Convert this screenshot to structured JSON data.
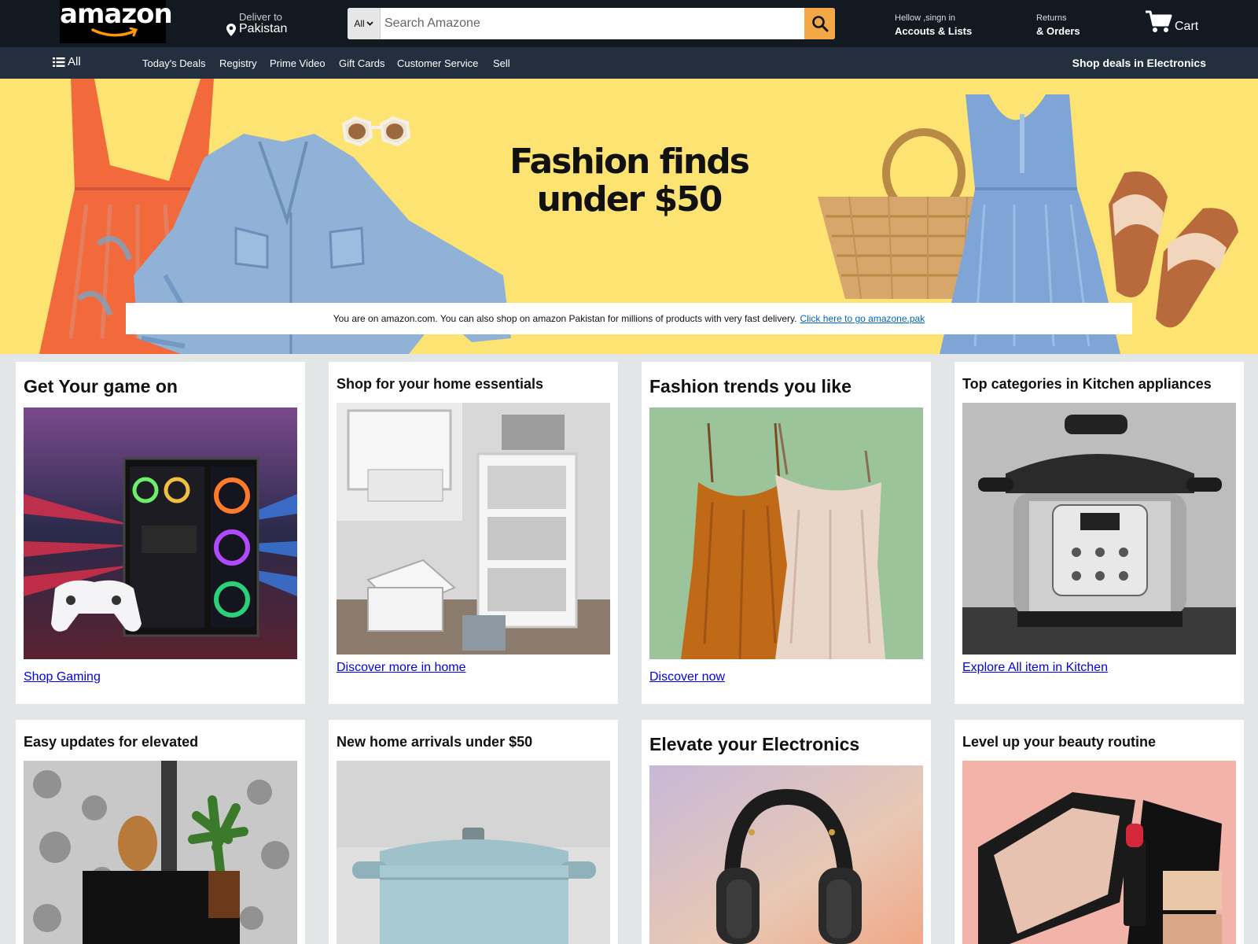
{
  "header": {
    "logo_text": "amazon",
    "deliver_label": "Deliver to",
    "deliver_location": "Pakistan",
    "search_category": "All",
    "search_placeholder": "Search Amazone",
    "account_greeting": "Hellow ,singn in",
    "account_label": "Accouts & Lists",
    "returns_label": "Returns",
    "orders_label": "& Orders",
    "cart_label": "Cart"
  },
  "subnav": {
    "all_label": "All",
    "items": [
      "Today's Deals",
      "Registry",
      "Prime Video",
      "Gift Cards",
      "Customer Service",
      "Sell"
    ],
    "promo": "Shop deals in Electronics"
  },
  "hero": {
    "title_line1": "Fashion finds",
    "title_line2": "under $50",
    "notice_text": "You are on amazon.com. You can also shop on amazon Pakistan for millions of products with very fast delivery.",
    "notice_link": "Click here to go amazone.pak"
  },
  "cards": [
    {
      "title": "Get Your game on",
      "link": "Shop Gaming",
      "image": "gaming-pc-and-controller"
    },
    {
      "title": "Shop for your home essentials",
      "link": "Discover more in home",
      "image": "home-storage-shelf"
    },
    {
      "title": "Fashion trends you like",
      "link": "Discover now",
      "image": "slip-dresses"
    },
    {
      "title": "Top categories in Kitchen appliances",
      "link": "Explore All item in Kitchen",
      "image": "pressure-cooker"
    },
    {
      "title": "Easy updates for elevated",
      "image": "home-decor"
    },
    {
      "title": "New home arrivals under $50",
      "image": "dutch-oven"
    },
    {
      "title": "Elevate your Electronics",
      "image": "headphones"
    },
    {
      "title": "Level up your beauty routine",
      "image": "makeup-palette"
    }
  ],
  "colors": {
    "header_bg": "#131921",
    "subnav_bg": "#232f3e",
    "hero_bg": "#fde472",
    "search_button": "#f3a847",
    "page_bg": "#e3e6e6"
  }
}
